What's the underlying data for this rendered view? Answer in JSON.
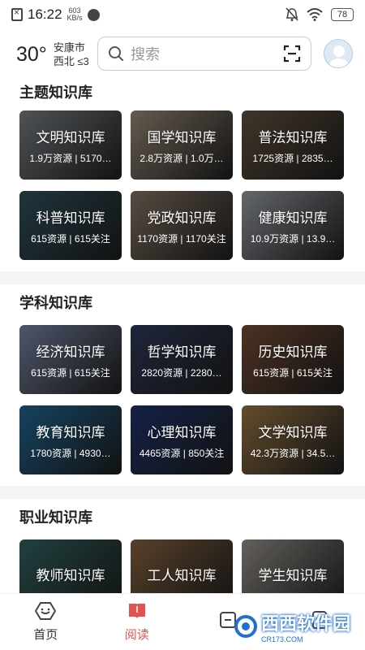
{
  "status": {
    "time": "16:22",
    "speed_value": "603",
    "speed_unit": "KB/s",
    "battery": "78"
  },
  "header": {
    "temperature": "30°",
    "city": "安康市",
    "wind": "西北 ≤3",
    "search_placeholder": "搜索"
  },
  "sections": [
    {
      "title": "主题知识库",
      "cards": [
        {
          "title": "文明知识库",
          "sub": "1.9万资源 | 5170…",
          "bg": "#6f7478"
        },
        {
          "title": "国学知识库",
          "sub": "2.8万资源 | 1.0万…",
          "bg": "#8b7e6e"
        },
        {
          "title": "普法知识库",
          "sub": "1725资源 | 2835…",
          "bg": "#5a4a3a"
        },
        {
          "title": "科普知识库",
          "sub": "615资源 | 615关注",
          "bg": "#2b4a55"
        },
        {
          "title": "党政知识库",
          "sub": "1170资源 | 1170关注",
          "bg": "#7a6a5c"
        },
        {
          "title": "健康知识库",
          "sub": "10.9万资源 | 13.9…",
          "bg": "#8a8e94"
        }
      ]
    },
    {
      "title": "学科知识库",
      "cards": [
        {
          "title": "经济知识库",
          "sub": "615资源 | 615关注",
          "bg": "#6d7894"
        },
        {
          "title": "哲学知识库",
          "sub": "2820资源 | 2280…",
          "bg": "#2a3552"
        },
        {
          "title": "历史知识库",
          "sub": "615资源 | 615关注",
          "bg": "#6a4530"
        },
        {
          "title": "教育知识库",
          "sub": "1780资源 | 4930…",
          "bg": "#1d5d86"
        },
        {
          "title": "心理知识库",
          "sub": "4465资源 | 850关注",
          "bg": "#1c2f63"
        },
        {
          "title": "文学知识库",
          "sub": "42.3万资源 | 34.5…",
          "bg": "#8a6a3e"
        }
      ]
    },
    {
      "title": "职业知识库",
      "cards": [
        {
          "title": "教师知识库",
          "sub": "",
          "bg": "#2e5a58"
        },
        {
          "title": "工人知识库",
          "sub": "",
          "bg": "#7a5a3a"
        },
        {
          "title": "学生知识库",
          "sub": "",
          "bg": "#8a8680"
        }
      ]
    }
  ],
  "nav": [
    {
      "label": "首页",
      "icon": "home-hex-icon",
      "active": false
    },
    {
      "label": "阅读",
      "icon": "book-icon",
      "active": true
    },
    {
      "label": "",
      "icon": "grid-icon",
      "active": false
    },
    {
      "label": "",
      "icon": "profile-icon",
      "active": false
    }
  ],
  "watermark": {
    "text": "西西软件园",
    "sub": "CR173.COM"
  },
  "colors": {
    "accent": "#e35353",
    "watermark": "#1e6fd1"
  }
}
